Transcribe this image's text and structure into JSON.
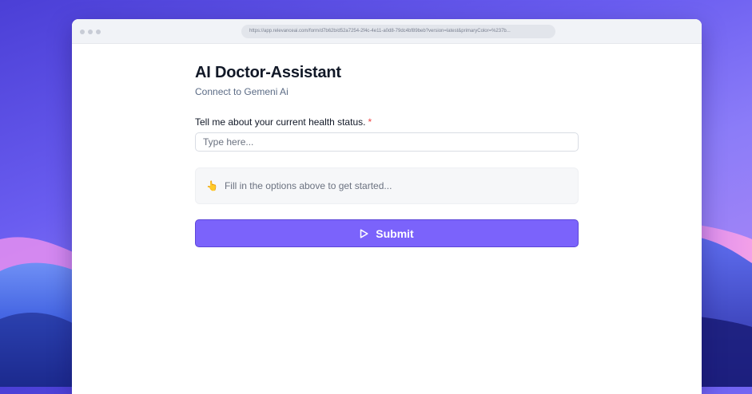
{
  "browser": {
    "url": "https://app.relevanceai.com/form/d7b62b/d52a7254-2f4c-4e11-a0d8-79dc4bf89beb?version=latest&primaryColor=%237b..."
  },
  "form": {
    "title": "AI Doctor-Assistant",
    "subtitle": "Connect to Gemeni Ai",
    "field_label": "Tell me about your current health status.",
    "required_marker": "*",
    "input_placeholder": "Type here...",
    "input_value": "",
    "hint_icon": "pointing-hand-icon",
    "hint_text": "Fill in the options above to get started...",
    "submit_icon": "play-icon",
    "submit_label": "Submit"
  },
  "colors": {
    "accent": "#7b63fb",
    "required": "#ef4444"
  }
}
